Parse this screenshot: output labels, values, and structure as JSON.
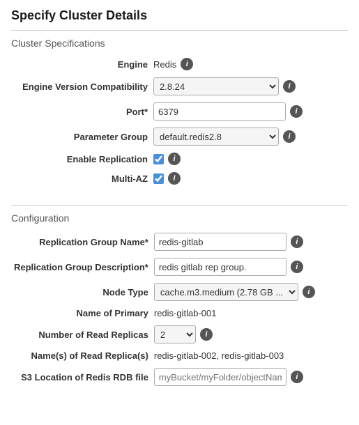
{
  "page": {
    "title": "Specify Cluster Details"
  },
  "cluster_specifications": {
    "section_title": "Cluster Specifications",
    "fields": [
      {
        "label": "Engine",
        "type": "static",
        "value": "Redis"
      },
      {
        "label": "Engine Version Compatibility",
        "type": "select",
        "value": "2.8.24"
      },
      {
        "label": "Port*",
        "type": "text",
        "value": "6379"
      },
      {
        "label": "Parameter Group",
        "type": "select",
        "value": "default.redis2.8"
      },
      {
        "label": "Enable Replication",
        "type": "checkbox",
        "checked": true
      },
      {
        "label": "Multi-AZ",
        "type": "checkbox",
        "checked": true
      }
    ]
  },
  "configuration": {
    "section_title": "Configuration",
    "fields": [
      {
        "label": "Replication Group Name*",
        "type": "text",
        "value": "redis-gitlab"
      },
      {
        "label": "Replication Group Description*",
        "type": "text",
        "value": "redis gitlab rep group."
      },
      {
        "label": "Node Type",
        "type": "select",
        "value": "cache.m3.medium (2.78 GB ..."
      },
      {
        "label": "Name of Primary",
        "type": "static",
        "value": "redis-gitlab-001"
      },
      {
        "label": "Number of Read Replicas",
        "type": "select",
        "value": "2"
      },
      {
        "label": "Name(s) of Read Replica(s)",
        "type": "static",
        "value": "redis-gitlab-002, redis-gitlab-003"
      },
      {
        "label": "S3 Location of Redis RDB file",
        "type": "text",
        "value": "",
        "placeholder": "myBucket/myFolder/objectName"
      }
    ]
  }
}
